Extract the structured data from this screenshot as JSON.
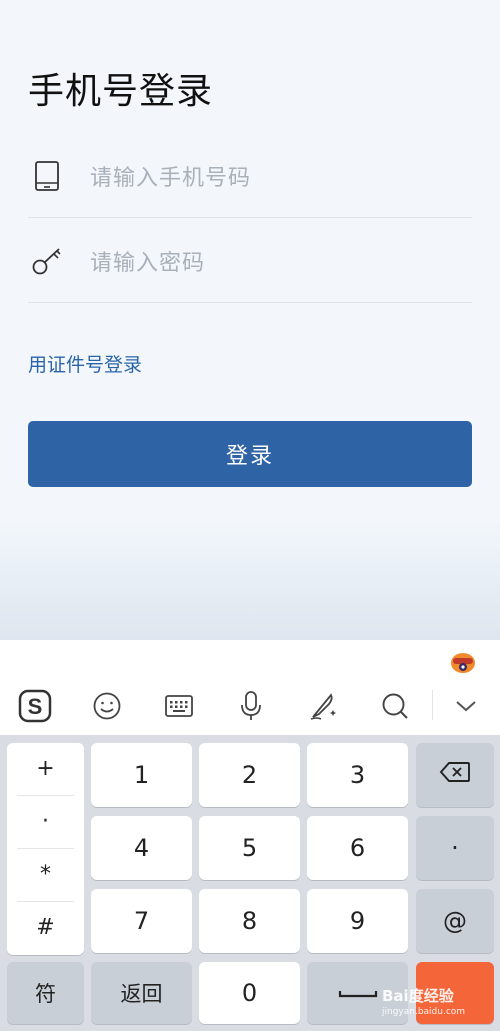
{
  "header": {
    "title": "手机号登录"
  },
  "form": {
    "phone_placeholder": "请输入手机号码",
    "password_placeholder": "请输入密码",
    "alt_login_link": "用证件号登录",
    "login_button": "登录"
  },
  "toolbar": {
    "icons": [
      "sogou-logo-icon",
      "emoji-icon",
      "keyboard-icon",
      "microphone-icon",
      "handwriting-icon",
      "search-icon",
      "chevron-down-icon"
    ]
  },
  "keyboard": {
    "symbols": [
      "+",
      "·",
      "*",
      "#"
    ],
    "row1": [
      "1",
      "2",
      "3"
    ],
    "row2": [
      "4",
      "5",
      "6"
    ],
    "row3": [
      "7",
      "8",
      "9"
    ],
    "dot_key": "·",
    "at_key": "@",
    "bottom": {
      "symbols": "符",
      "back": "返回",
      "zero": "0"
    }
  },
  "watermark": {
    "brand": "Bai度经验",
    "url": "jingyan.baidu.com"
  },
  "colors": {
    "primary": "#2e63a6",
    "link": "#2a64a8",
    "enter": "#f4663a"
  }
}
